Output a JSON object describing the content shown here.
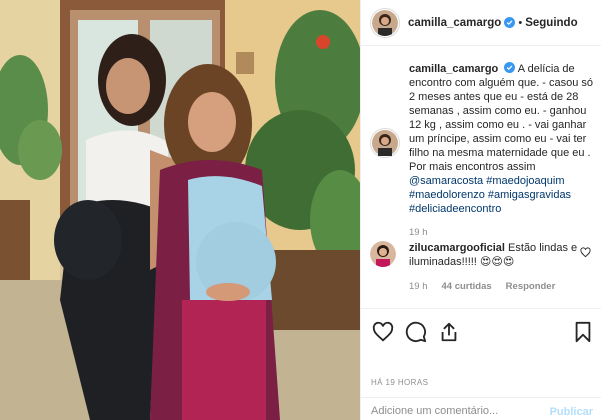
{
  "post": {
    "author": "camilla_camargo",
    "follow_status": "Seguindo",
    "separator": "•"
  },
  "caption": {
    "author": "camilla_camargo",
    "text": "A delícia de encontro com alguém que. - casou só 2 meses antes que eu - está de 28 semanas , assim como eu. - ganhou 12 kg , assim como eu . - vai ganhar um príncipe, assim como eu - vai ter filho na mesma maternidade que eu . Por mais encontros assim",
    "hashtags": [
      "@samaracosta",
      "#maedojoaquim",
      "#maedolorenzo",
      "#amigasgravidas",
      "#deliciadeencontro"
    ],
    "time": "19 h"
  },
  "reply": {
    "author": "zilucamargooficial",
    "text": "Estão lindas e iluminadas!!!!! 😍😍😍",
    "time": "19 h",
    "likes": "44 curtidas",
    "reply_label": "Responder"
  },
  "timestamp": "HÁ 19 HORAS",
  "comment_box": {
    "placeholder": "Adicione um comentário...",
    "publish_label": "Publicar"
  },
  "icons": {
    "like": "heart-icon",
    "comment": "comment-icon",
    "share": "share-icon",
    "save": "bookmark-icon",
    "verified": "verified-badge-icon",
    "small_like": "heart-icon"
  },
  "colors": {
    "link": "#00376b",
    "verified": "#3897f0",
    "muted": "#8e8e8e",
    "publish_disabled": "#b2dffc"
  }
}
